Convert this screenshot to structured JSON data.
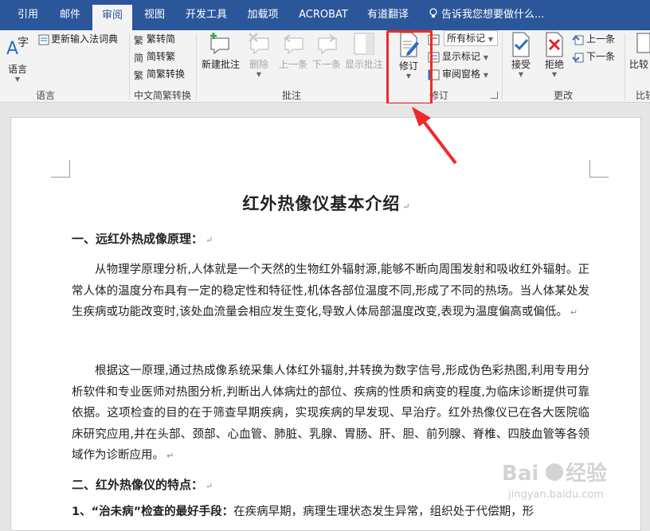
{
  "tabs": [
    {
      "label": "引用",
      "active": false
    },
    {
      "label": "邮件",
      "active": false
    },
    {
      "label": "审阅",
      "active": true
    },
    {
      "label": "视图",
      "active": false
    },
    {
      "label": "开发工具",
      "active": false
    },
    {
      "label": "加载项",
      "active": false
    },
    {
      "label": "ACROBAT",
      "active": false
    },
    {
      "label": "有道翻译",
      "active": false
    }
  ],
  "tellme": "告诉我您想要做什么...",
  "ribbon": {
    "language": {
      "lang_label": "语言",
      "update_ime": "更新输入法词典",
      "group": "语言"
    },
    "chinese": {
      "t2s": "繁转简",
      "s2t": "简转繁",
      "convert": "简繁转换",
      "group": "中文简繁转换"
    },
    "comments": {
      "new": "新建批注",
      "delete": "删除",
      "prev": "上一条",
      "next": "下一条",
      "show": "显示批注",
      "group": "批注"
    },
    "tracking": {
      "track": "修订",
      "markup": "所有标记",
      "show_markup": "显示标记",
      "pane": "审阅窗格",
      "group": "修订"
    },
    "changes": {
      "accept": "接受",
      "reject": "拒绝",
      "prev": "上一条",
      "next": "下一条",
      "group": "更改"
    },
    "compare": {
      "label": "比较",
      "group": "比较"
    }
  },
  "document": {
    "title": "红外热像仪基本介绍",
    "h1": "一、远红外热成像原理：",
    "p1": "从物理学原理分析,人体就是一个天然的生物红外辐射源,能够不断向周围发射和吸收红外辐射。正常人体的温度分布具有一定的稳定性和特征性,机体各部位温度不同,形成了不同的热场。当人体某处发生疾病或功能改变时,该处血流量会相应发生变化,导致人体局部温度改变,表现为温度偏高或偏低。",
    "p2": "根据这一原理,通过热成像系统采集人体红外辐射,并转换为数字信号,形成伪色彩热图,利用专用分析软件和专业医师对热图分析,判断出人体病灶的部位、疾病的性质和病变的程度,为临床诊断提供可靠依据。这项检查的目的在于筛查早期疾病，实现疾病的早发现、早治疗。红外热像仪已在各大医院临床研究应用,并在头部、颈部、心血管、肺脏、乳腺、胃肠、肝、胆、前列腺、脊椎、四肢血管等各领域作为诊断应用。",
    "h2": "二、红外热像仪的特点：",
    "p3_bold": "1、“治未病”检查的最好手段：",
    "p3": "在疾病早期，病理生理状态发生异常，组织处于代偿期，形",
    "para_mark": "↵"
  },
  "watermark": {
    "brand": "Baidu",
    "cn": "经验",
    "url": "jingyan.baidu.com"
  },
  "colors": {
    "tab_bg": "#2b579a",
    "highlight": "#ee2b2b",
    "ribbon_bg": "#f3f3f3"
  }
}
